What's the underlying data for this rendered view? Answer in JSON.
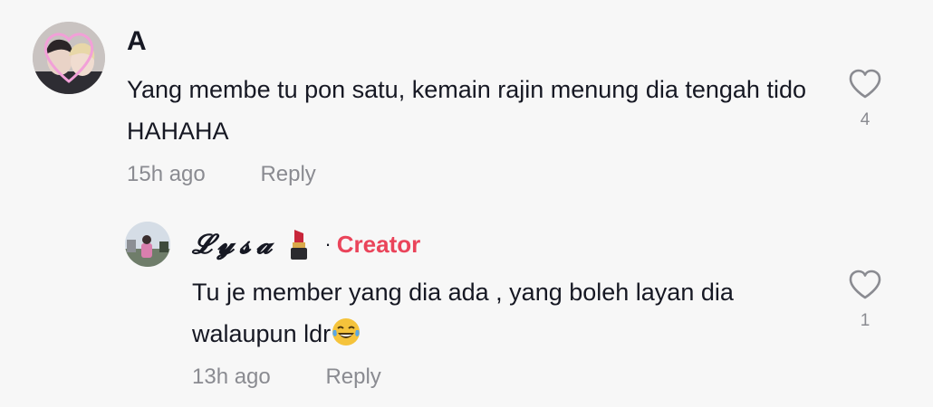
{
  "comments": [
    {
      "username": "A",
      "text": "Yang membe tu pon satu, kemain rajin menung dia tengah tido HAHAHA",
      "time": "15h ago",
      "reply_label": "Reply",
      "likes": "4",
      "avatar_icon": "couple-photo-heart-frame"
    }
  ],
  "reply": {
    "username": "𝓛𝔂𝓼𝓪",
    "badge_separator": "·",
    "badge": "Creator",
    "badge_color": "#ea445a",
    "text": "Tu je member yang dia ada , yang boleh layan dia walaupun ldr",
    "emoji_icon": "face-with-tears-of-joy-icon",
    "name_icon": "lipstick-icon",
    "time": "13h ago",
    "reply_label": "Reply",
    "likes": "1",
    "avatar_icon": "outdoor-photo"
  },
  "colors": {
    "text": "#161823",
    "meta": "#8a8b91",
    "background": "#f7f7f7"
  }
}
